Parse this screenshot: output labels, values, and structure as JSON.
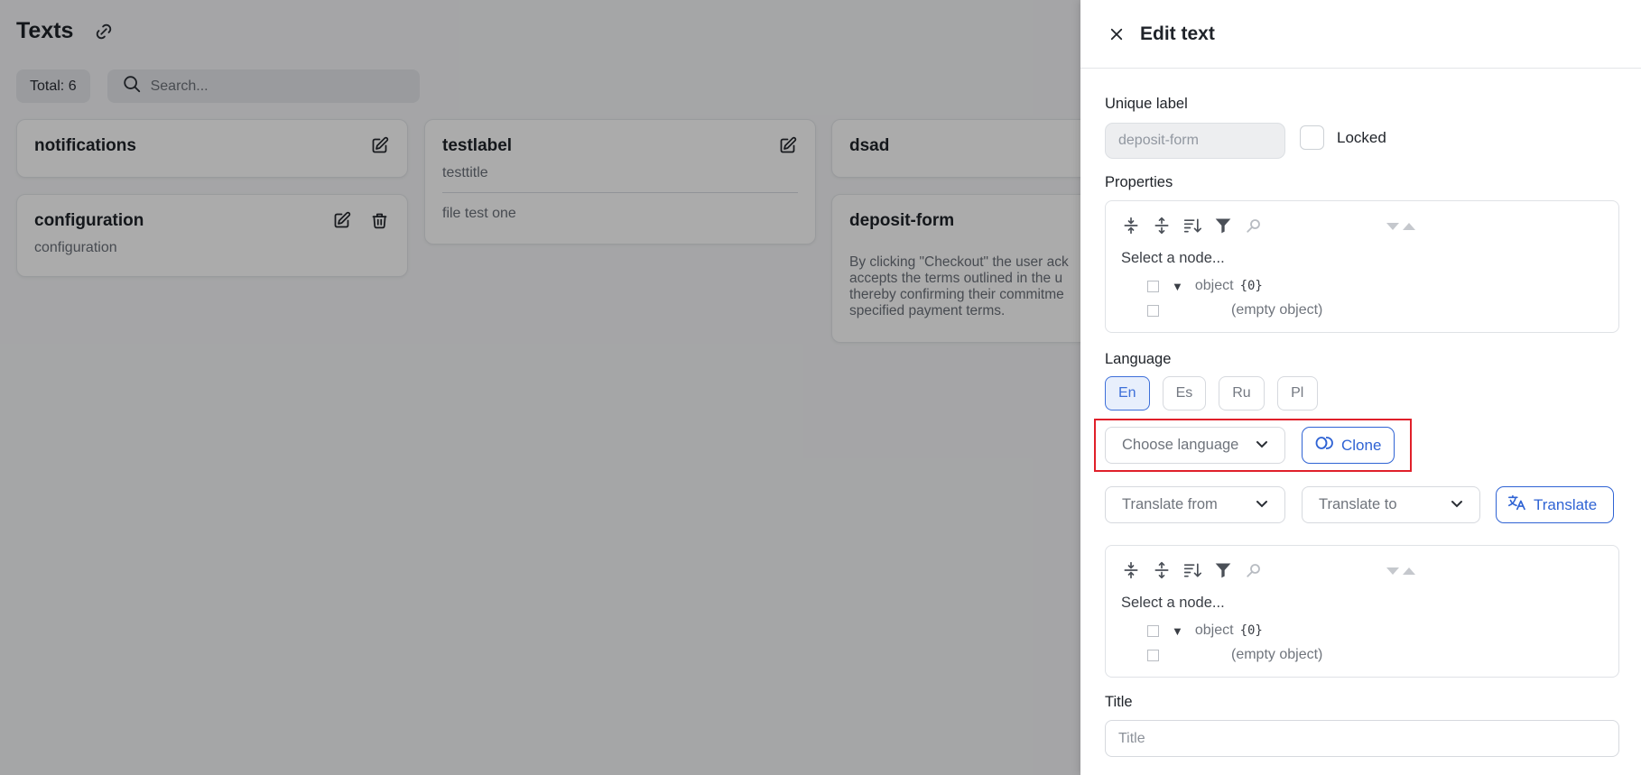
{
  "page": {
    "title": "Texts",
    "total_label": "Total: 6",
    "search_placeholder": "Search..."
  },
  "cards": {
    "notifications": {
      "title": "notifications"
    },
    "testlabel": {
      "title": "testlabel",
      "subtitle": "testtitle",
      "body": "file test one"
    },
    "dsad": {
      "title": "dsad"
    },
    "configuration": {
      "title": "configuration",
      "subtitle": "configuration"
    },
    "deposit_form": {
      "title": "deposit-form",
      "body": "By clicking \"Checkout\" the user ack\naccepts the terms outlined in the u\nthereby confirming their commitme\nspecified payment terms."
    }
  },
  "drawer": {
    "title": "Edit text",
    "unique_label": {
      "label": "Unique label",
      "value": "deposit-form"
    },
    "locked_label": "Locked",
    "properties_label": "Properties",
    "json_editor": {
      "select_node": "Select a node...",
      "root_key": "object",
      "root_count": "{0}",
      "empty": "(empty object)"
    },
    "language_label": "Language",
    "languages": [
      "En",
      "Es",
      "Ru",
      "Pl"
    ],
    "active_language": "En",
    "choose_language_placeholder": "Choose language",
    "clone_label": "Clone",
    "translate_from_placeholder": "Translate from",
    "translate_to_placeholder": "Translate to",
    "translate_label": "Translate",
    "title_label": "Title",
    "title_placeholder": "Title"
  },
  "colors": {
    "accent": "#2f63d4",
    "highlight": "#e0202a",
    "overlay": "rgba(0,0,0,0.33)"
  }
}
